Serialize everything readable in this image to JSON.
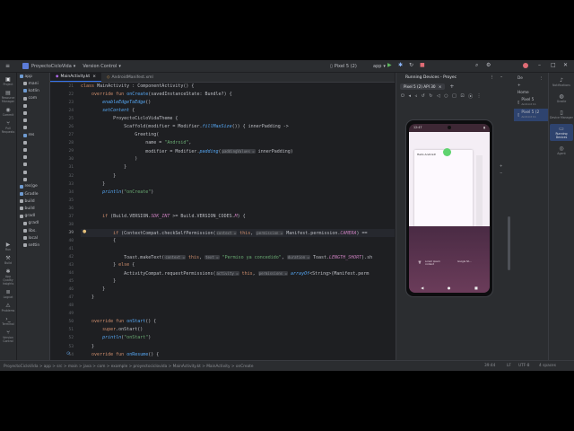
{
  "title_bar": {
    "project": "ProyectoCicloVida",
    "vcs": "Version Control",
    "device": "Pixel 5 (2)",
    "run_config": "app"
  },
  "left_tools": [
    {
      "label": "Project",
      "icon": "folder-icon"
    },
    {
      "label": "Resource Manager",
      "icon": "resource-icon"
    },
    {
      "label": "Commit",
      "icon": "commit-icon"
    },
    {
      "label": "Pull Requests",
      "icon": "pull-request-icon"
    },
    {
      "label": "Run",
      "icon": "run-icon"
    },
    {
      "label": "Build",
      "icon": "hammer-icon"
    },
    {
      "label": "App Quality Insights",
      "icon": "bug-icon"
    },
    {
      "label": "Logcat",
      "icon": "logcat-icon"
    },
    {
      "label": "Problems",
      "icon": "problems-icon"
    },
    {
      "label": "Terminal",
      "icon": "terminal-icon"
    },
    {
      "label": "Version Control",
      "icon": "git-icon"
    }
  ],
  "project_tree": [
    {
      "label": "app",
      "color": "#6f9bd1"
    },
    {
      "label": "mani",
      "color": "#a8abb0"
    },
    {
      "label": "kotlin",
      "color": "#6f9bd1"
    },
    {
      "label": "com",
      "color": "#a8abb0"
    },
    {
      "label": "",
      "color": "#a8abb0"
    },
    {
      "label": "",
      "color": "#a8abb0"
    },
    {
      "label": "",
      "color": "#a8abb0"
    },
    {
      "label": "",
      "color": "#a8abb0"
    },
    {
      "label": "res",
      "color": "#6f9bd1"
    },
    {
      "label": "",
      "color": "#a8abb0"
    },
    {
      "label": "",
      "color": "#a8abb0"
    },
    {
      "label": "",
      "color": "#a8abb0"
    },
    {
      "label": "",
      "color": "#a8abb0"
    },
    {
      "label": "",
      "color": "#a8abb0"
    },
    {
      "label": "",
      "color": "#a8abb0"
    },
    {
      "label": "res(ge",
      "color": "#6f9bd1"
    },
    {
      "label": "Gradle",
      "color": "#6f9bd1"
    },
    {
      "label": "build",
      "color": "#a8abb0"
    },
    {
      "label": "build",
      "color": "#a8abb0"
    },
    {
      "label": "gradl",
      "color": "#a8abb0"
    },
    {
      "label": "gradl",
      "color": "#a8abb0"
    },
    {
      "label": "libs.",
      "color": "#a8abb0"
    },
    {
      "label": "local",
      "color": "#a8abb0"
    },
    {
      "label": "settin",
      "color": "#a8abb0"
    }
  ],
  "editor": {
    "tabs": [
      "MainActivity.kt",
      "AndroidManifest.xml"
    ],
    "line_numbers": [
      "21",
      "22",
      "23",
      "24",
      "25",
      "26",
      "27",
      "28",
      "29",
      "30",
      "31",
      "32",
      "33",
      "34",
      "35",
      "36",
      "37",
      "38",
      "39",
      "40",
      "41",
      "42",
      "43",
      "44",
      "45",
      "46",
      "47",
      "48",
      "49",
      "50",
      "51",
      "52",
      "53",
      "54",
      "55",
      "56",
      "57"
    ],
    "current_line_index": 18
  },
  "code_lines": [
    [
      [
        "kw",
        "class "
      ],
      [
        "cls",
        "MainActivity : ComponentActivity() {"
      ]
    ],
    [
      [
        "kw",
        "    override fun "
      ],
      [
        "fn",
        "onCreate"
      ],
      [
        "cls",
        "(savedInstanceState: Bundle?) {"
      ]
    ],
    [
      [
        "it",
        "        enableEdgeToEdge"
      ],
      [
        "cls",
        "()"
      ]
    ],
    [
      [
        "it",
        "        setContent "
      ],
      [
        "cls",
        "{"
      ]
    ],
    [
      [
        "cls",
        "            ProyectoCicloVidaTheme {"
      ]
    ],
    [
      [
        "cls",
        "                Scaffold(modifier = Modifier."
      ],
      [
        "it",
        "fillMaxSize"
      ],
      [
        "cls",
        "()) { innerPadding ->"
      ]
    ],
    [
      [
        "cls",
        "                    Greeting("
      ]
    ],
    [
      [
        "cls",
        "                        name = "
      ],
      [
        "str",
        "\"Android\""
      ],
      [
        "cls",
        ","
      ]
    ],
    [
      [
        "cls",
        "                        modifier = Modifier."
      ],
      [
        "it",
        "padding"
      ],
      [
        "cls",
        "("
      ],
      [
        "hint",
        "paddingValues ="
      ],
      [
        "cls",
        " innerPadding)"
      ]
    ],
    [
      [
        "cls",
        "                    )"
      ]
    ],
    [
      [
        "cls",
        "                }"
      ]
    ],
    [
      [
        "cls",
        "            }"
      ]
    ],
    [
      [
        "cls",
        "        }"
      ]
    ],
    [
      [
        "it",
        "        println"
      ],
      [
        "cls",
        "("
      ],
      [
        "str",
        "\"onCreate\""
      ],
      [
        "cls",
        ")"
      ]
    ],
    [
      [
        "cls",
        ""
      ]
    ],
    [
      [
        "cls",
        ""
      ]
    ],
    [
      [
        "kw",
        "        if "
      ],
      [
        "cls",
        "(Build.VERSION."
      ],
      [
        "const",
        "SDK_INT"
      ],
      [
        "cls",
        " >= Build.VERSION_CODES."
      ],
      [
        "const",
        "M"
      ],
      [
        "cls",
        ") {"
      ]
    ],
    [
      [
        "cls",
        ""
      ]
    ],
    [
      [
        "kw",
        "            if "
      ],
      [
        "cls",
        "(ContextCompat.checkSelfPermission("
      ],
      [
        "hint",
        "context ="
      ],
      [
        "kw",
        " this"
      ],
      [
        "cls",
        ", "
      ],
      [
        "hint",
        "permission ="
      ],
      [
        "cls",
        " Manifest.permission."
      ],
      [
        "const",
        "CAMERA"
      ],
      [
        "cls",
        ") =="
      ]
    ],
    [
      [
        "cls",
        "            {"
      ]
    ],
    [
      [
        "cls",
        ""
      ]
    ],
    [
      [
        "cls",
        "                Toast.makeText("
      ],
      [
        "hint",
        "context ="
      ],
      [
        "kw",
        " this"
      ],
      [
        "cls",
        ", "
      ],
      [
        "hint",
        "text ="
      ],
      [
        "str",
        " \"Permiso ya concedido\""
      ],
      [
        "cls",
        ", "
      ],
      [
        "hint",
        "duration ="
      ],
      [
        "cls",
        " Toast."
      ],
      [
        "const",
        "LENGTH_SHORT"
      ],
      [
        "cls",
        ").sh"
      ]
    ],
    [
      [
        "cls",
        "            } "
      ],
      [
        "kw",
        "else "
      ],
      [
        "cls",
        "{"
      ]
    ],
    [
      [
        "cls",
        "                ActivityCompat.requestPermissions("
      ],
      [
        "hint",
        "activity ="
      ],
      [
        "kw",
        " this"
      ],
      [
        "cls",
        ", "
      ],
      [
        "hint",
        "permissions ="
      ],
      [
        "it",
        " arrayOf"
      ],
      [
        "cls",
        "<String>(Manifest.perm"
      ]
    ],
    [
      [
        "cls",
        "            }"
      ]
    ],
    [
      [
        "cls",
        "        }"
      ]
    ],
    [
      [
        "cls",
        "    }"
      ]
    ],
    [
      [
        "cls",
        ""
      ]
    ],
    [
      [
        "cls",
        ""
      ]
    ],
    [
      [
        "kw",
        "    override fun "
      ],
      [
        "fn",
        "onStart"
      ],
      [
        "cls",
        "() {"
      ]
    ],
    [
      [
        "kw",
        "        super"
      ],
      [
        "cls",
        ".onStart()"
      ]
    ],
    [
      [
        "it",
        "        println"
      ],
      [
        "cls",
        "("
      ],
      [
        "str",
        "\"onStart\""
      ],
      [
        "cls",
        ")"
      ]
    ],
    [
      [
        "cls",
        "    }"
      ]
    ],
    [
      [
        "kw",
        "    override fun "
      ],
      [
        "fn",
        "onResume"
      ],
      [
        "cls",
        "() {"
      ]
    ],
    [
      [
        "kw",
        "        super"
      ],
      [
        "cls",
        ".onResume()"
      ]
    ],
    [
      [
        "it",
        "        println"
      ],
      [
        "cls",
        "("
      ],
      [
        "str",
        "\"onResume\""
      ],
      [
        "cls",
        ")"
      ]
    ],
    [
      [
        "cls",
        "    }"
      ]
    ]
  ],
  "running_devices": {
    "title": "Running Devices - Proyec",
    "tab": "Pixel 5 (2) API 30",
    "clock": "12:47",
    "app_text": "Hello Android!",
    "bottom_left": "Lorem ipsum content",
    "bottom_right": "Google Sh..."
  },
  "device_manager": {
    "title": "De",
    "home": "Home",
    "rows": [
      {
        "name": "Pixel 5",
        "sub": "Android 11"
      },
      {
        "name": "Pixel 5 (2",
        "sub": "Android 11"
      }
    ]
  },
  "right_tools": [
    {
      "label": "Notifications",
      "icon": "bell-icon"
    },
    {
      "label": "Gradle",
      "icon": "elephant-icon"
    },
    {
      "label": "Device Manager",
      "icon": "phone-icon"
    },
    {
      "label": "Running Devices",
      "icon": "device-icon"
    },
    {
      "label": "Agent",
      "icon": "agent-icon"
    }
  ],
  "status_bar": {
    "breadcrumb": "ProyectoCicloVida > app > src > main > java > com > example > proyectociclovida > MainActivity.kt > MainActivity > onCreate",
    "position": "39:44",
    "line_sep": "LF",
    "encoding": "UTF-8",
    "indent": "4 spaces"
  }
}
